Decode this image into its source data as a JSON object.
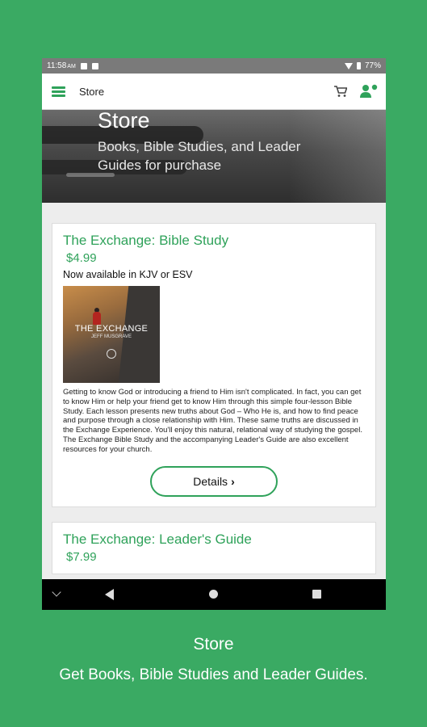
{
  "status_bar": {
    "time": "11:58",
    "ampm": "AM",
    "battery": "77%"
  },
  "app_bar": {
    "title": "Store"
  },
  "hero": {
    "title": "Store",
    "subtitle": "Books, Bible Studies, and Leader Guides for purchase"
  },
  "products": [
    {
      "title": "The Exchange: Bible Study",
      "price": "$4.99",
      "note": "Now available in KJV or ESV",
      "cover_title": "THE EXCHANGE",
      "cover_author": "JEFF MUSGRAVE",
      "description": "Getting to know God or introducing a friend to Him isn't complicated. In fact, you can get to know Him or help your friend get to know Him through this simple four-lesson Bible Study. Each lesson presents new truths about God – Who He is, and how to find peace and purpose through a close relationship with Him. These same truths are discussed in the Exchange Experience. You'll enjoy this natural, relational way of studying the gospel. The Exchange Bible Study and the accompanying Leader's Guide are also excellent resources for your church.",
      "details_label": "Details",
      "details_chevron": "›"
    },
    {
      "title": "The Exchange: Leader's Guide",
      "price": "$7.99"
    }
  ],
  "caption": {
    "title": "Store",
    "subtitle": "Get Books, Bible Studies and Leader Guides."
  },
  "colors": {
    "brand_green": "#2fa25a",
    "background_green": "#3aaa63"
  },
  "icons": [
    "menu-icon",
    "cart-icon",
    "account-icon",
    "back-icon",
    "home-icon",
    "recents-icon"
  ]
}
